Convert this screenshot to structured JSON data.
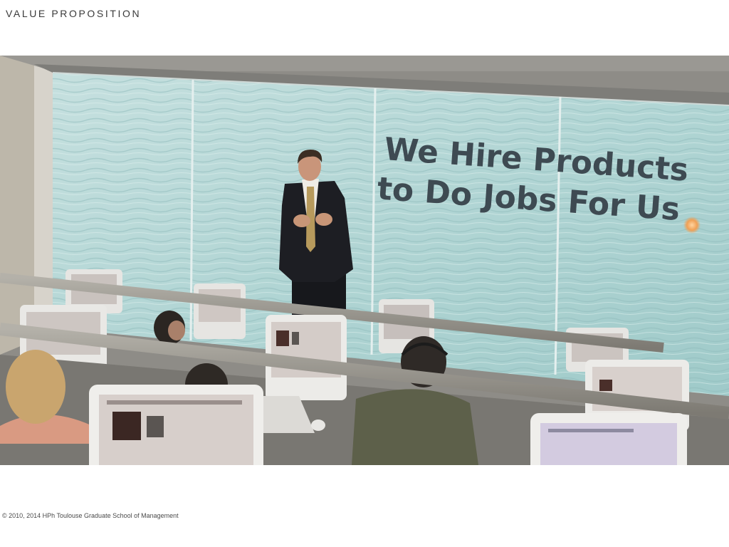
{
  "slide": {
    "title": "VALUE PROPOSITION",
    "footer": "© 2010, 2014 HPh Toulouse Graduate School of Management"
  },
  "photo": {
    "projected_text_line1": "We Hire Products",
    "projected_text_line2": "to Do Jobs For Us"
  },
  "colors": {
    "title": "#3a3a3a",
    "footer": "#4a4a4a",
    "projected_text": "#3e4a52",
    "water": "#b3d6d5"
  }
}
